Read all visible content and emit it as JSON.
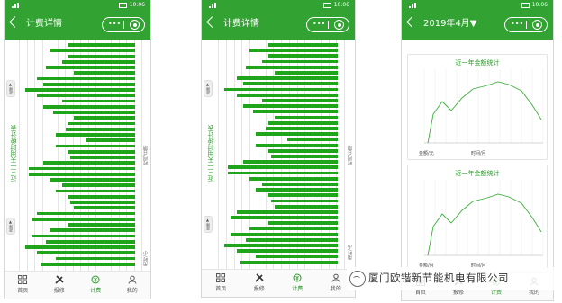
{
  "status": {
    "time": "10:06"
  },
  "screens": [
    {
      "id": "p1",
      "title": "计费详情",
      "side_text": "近三一天用时统计表",
      "side_text_right": "时间/日期",
      "chip_top": "故障▼",
      "chip_bottom": "故障▼",
      "bottom_label": "用时/小"
    },
    {
      "id": "p2",
      "title": "计费详情",
      "side_text": "近三一天用时统计表",
      "side_text_right": "时间/日期",
      "chip_top": "故障▼",
      "chip_bottom": "故障▼",
      "bottom_label": "用时/小"
    },
    {
      "id": "p3",
      "title": "2019年4月▼"
    }
  ],
  "tabs": [
    {
      "label": "首页",
      "icon": "grid-icon"
    },
    {
      "label": "报修",
      "icon": "wrench-icon"
    },
    {
      "label": "计费",
      "icon": "coin-icon",
      "active": true
    },
    {
      "label": "我的",
      "icon": "user-icon"
    }
  ],
  "line_charts": [
    {
      "title": "近一年金额统计",
      "ylabel": "金额/元",
      "xlabel": "时间/月"
    },
    {
      "title": "近一年金额统计",
      "ylabel": "金额/台",
      "xlabel": "时间/月"
    }
  ],
  "accent": "#32a232",
  "bar_color": "#1fa51a",
  "watermark": "厦门欧锴新节能机电有限公司"
}
